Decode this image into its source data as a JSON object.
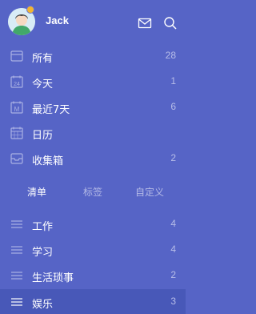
{
  "user": {
    "name": "Jack"
  },
  "header": {
    "icons": [
      "mail-icon",
      "search-icon"
    ]
  },
  "smart_lists": [
    {
      "label": "所有",
      "count": "28",
      "icon": "inbox-icon"
    },
    {
      "label": "今天",
      "count": "1",
      "icon": "calendar-24-icon"
    },
    {
      "label": "最近7天",
      "count": "6",
      "icon": "calendar-week-icon"
    },
    {
      "label": "日历",
      "count": "",
      "icon": "calendar-icon"
    },
    {
      "label": "收集箱",
      "count": "2",
      "icon": "tray-icon"
    }
  ],
  "tabs": [
    {
      "label": "清单",
      "active": true
    },
    {
      "label": "标签",
      "active": false
    },
    {
      "label": "自定义",
      "active": false
    }
  ],
  "lists": [
    {
      "label": "工作",
      "count": "4"
    },
    {
      "label": "学习",
      "count": "4"
    },
    {
      "label": "生活琐事",
      "count": "2"
    },
    {
      "label": "娱乐",
      "count": "3",
      "selected": true
    }
  ],
  "colors": {
    "background": "#5664c6",
    "selected_row": "#4858b8",
    "muted_text": "#b7bde8",
    "badge": "#f2b531"
  }
}
